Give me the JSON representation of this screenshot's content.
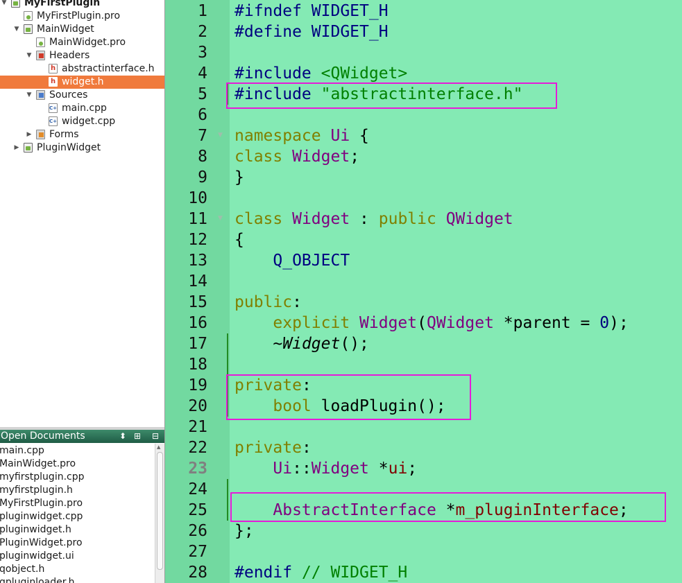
{
  "project_tree": {
    "items": [
      {
        "label": "MyFirstPlugin",
        "icon": "project-icon",
        "arrow": "▼",
        "bold": true
      },
      {
        "label": "MyFirstPlugin.pro",
        "icon": "pro-file-icon"
      },
      {
        "label": "MainWidget",
        "icon": "project-icon",
        "arrow": "▼"
      },
      {
        "label": "MainWidget.pro",
        "icon": "pro-file-icon"
      },
      {
        "label": "Headers",
        "icon": "headers-folder-icon",
        "arrow": "▼"
      },
      {
        "label": "abstractinterface.h",
        "icon": "header-file-icon"
      },
      {
        "label": "widget.h",
        "icon": "header-file-icon",
        "selected": true
      },
      {
        "label": "Sources",
        "icon": "sources-folder-icon",
        "arrow": "▼"
      },
      {
        "label": "main.cpp",
        "icon": "cpp-file-icon"
      },
      {
        "label": "widget.cpp",
        "icon": "cpp-file-icon"
      },
      {
        "label": "Forms",
        "icon": "forms-folder-icon",
        "arrow": "▶"
      },
      {
        "label": "PluginWidget",
        "icon": "project-icon",
        "arrow": "▶"
      }
    ]
  },
  "open_documents": {
    "title": "Open Documents",
    "items": [
      "main.cpp",
      "MainWidget.pro",
      "myfirstplugin.cpp",
      "myfirstplugin.h",
      "MyFirstPlugin.pro",
      "pluginwidget.cpp",
      "pluginwidget.h",
      "PluginWidget.pro",
      "pluginwidget.ui",
      "qobject.h",
      "qpluginloader.h"
    ]
  },
  "editor": {
    "current_line": 23,
    "lines": [
      {
        "n": "1",
        "t": [
          [
            "pp",
            "#ifndef WIDGET_H"
          ]
        ]
      },
      {
        "n": "2",
        "t": [
          [
            "pp",
            "#define WIDGET_H"
          ]
        ]
      },
      {
        "n": "3",
        "t": []
      },
      {
        "n": "4",
        "t": [
          [
            "pp",
            "#include "
          ],
          [
            "ppinc",
            "<QWidget>"
          ]
        ]
      },
      {
        "n": "5",
        "t": [
          [
            "pp",
            "#include "
          ],
          [
            "ppinc",
            "\"abstractinterface.h\""
          ]
        ]
      },
      {
        "n": "6",
        "t": []
      },
      {
        "n": "7",
        "t": [
          [
            "kw",
            "namespace"
          ],
          [
            "",
            " "
          ],
          [
            "ty",
            "Ui"
          ],
          [
            "",
            " {"
          ]
        ]
      },
      {
        "n": "8",
        "t": [
          [
            "kw",
            "class"
          ],
          [
            "",
            " "
          ],
          [
            "ty",
            "Widget"
          ],
          [
            "",
            ";"
          ]
        ]
      },
      {
        "n": "9",
        "t": [
          [
            "",
            "}"
          ]
        ]
      },
      {
        "n": "10",
        "t": []
      },
      {
        "n": "11",
        "t": [
          [
            "kw",
            "class"
          ],
          [
            "",
            " "
          ],
          [
            "ty",
            "Widget"
          ],
          [
            "",
            " : "
          ],
          [
            "kw",
            "public"
          ],
          [
            "",
            " "
          ],
          [
            "ty",
            "QWidget"
          ]
        ]
      },
      {
        "n": "12",
        "t": [
          [
            "",
            "{"
          ]
        ]
      },
      {
        "n": "13",
        "t": [
          [
            "",
            "    "
          ],
          [
            "mac",
            "Q_OBJECT"
          ]
        ]
      },
      {
        "n": "14",
        "t": []
      },
      {
        "n": "15",
        "t": [
          [
            "kw",
            "public"
          ],
          [
            "",
            ":"
          ]
        ]
      },
      {
        "n": "16",
        "t": [
          [
            "",
            "    "
          ],
          [
            "kw",
            "explicit"
          ],
          [
            "",
            " "
          ],
          [
            "ty",
            "Widget"
          ],
          [
            "",
            "("
          ],
          [
            "ty",
            "QWidget"
          ],
          [
            "",
            " *parent = "
          ],
          [
            "num",
            "0"
          ],
          [
            "",
            ");"
          ]
        ]
      },
      {
        "n": "17",
        "t": [
          [
            "",
            "    ~"
          ],
          [
            "it",
            "Widget"
          ],
          [
            "",
            "();"
          ]
        ]
      },
      {
        "n": "18",
        "t": []
      },
      {
        "n": "19",
        "t": [
          [
            "kw",
            "private"
          ],
          [
            "",
            ":"
          ]
        ]
      },
      {
        "n": "20",
        "t": [
          [
            "",
            "    "
          ],
          [
            "kw",
            "bool"
          ],
          [
            "",
            " loadPlugin();"
          ]
        ]
      },
      {
        "n": "21",
        "t": []
      },
      {
        "n": "22",
        "t": [
          [
            "kw",
            "private"
          ],
          [
            "",
            ":"
          ]
        ]
      },
      {
        "n": "23",
        "t": [
          [
            "",
            "    "
          ],
          [
            "ty",
            "Ui"
          ],
          [
            "",
            "::"
          ],
          [
            "ty",
            "Widget"
          ],
          [
            "",
            " *"
          ],
          [
            "fld",
            "ui"
          ],
          [
            "",
            ";"
          ]
        ]
      },
      {
        "n": "24",
        "t": []
      },
      {
        "n": "25",
        "t": [
          [
            "",
            "    "
          ],
          [
            "ty",
            "AbstractInterface"
          ],
          [
            "",
            " *"
          ],
          [
            "fld",
            "m_pluginInterface"
          ],
          [
            "",
            ";"
          ]
        ]
      },
      {
        "n": "26",
        "t": [
          [
            "",
            "};"
          ]
        ]
      },
      {
        "n": "27",
        "t": []
      },
      {
        "n": "28",
        "t": [
          [
            "pp",
            "#endif "
          ],
          [
            "cmt",
            "// WIDGET_H"
          ]
        ]
      }
    ]
  },
  "colors": {
    "editor_bg": "#84eab4",
    "gutter_bg": "#72d9a0",
    "highlight_box": "#e51bd9",
    "selection": "#f07a3c"
  }
}
